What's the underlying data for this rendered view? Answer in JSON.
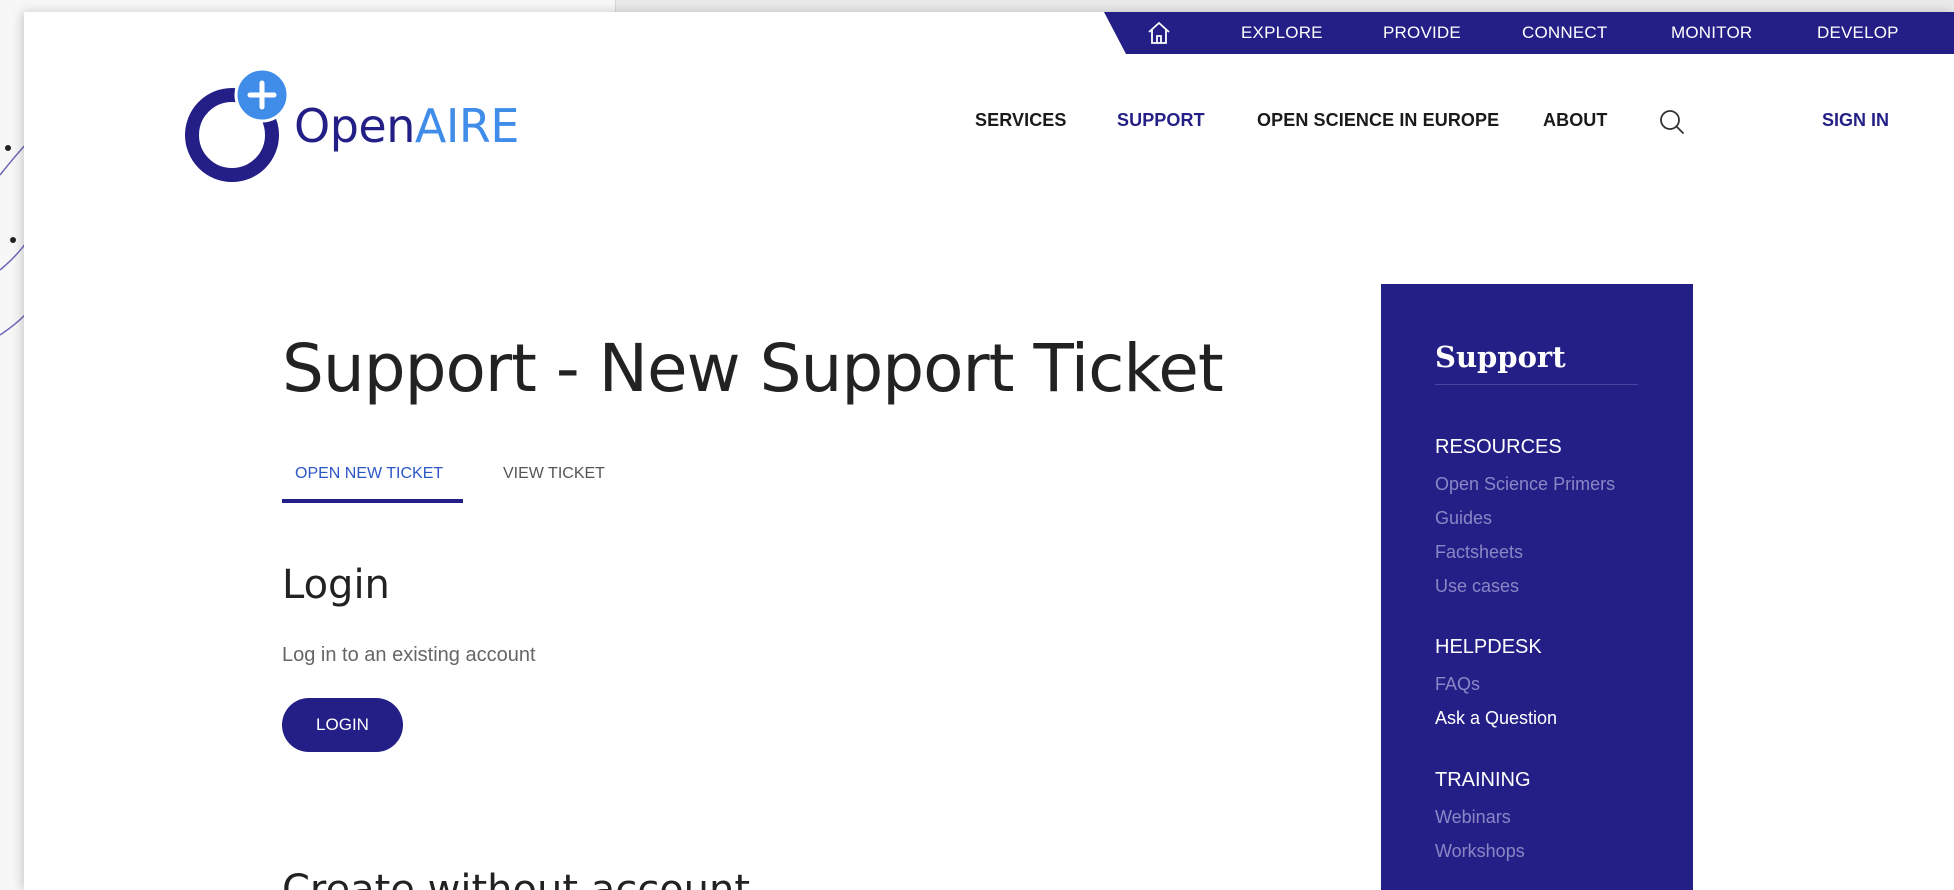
{
  "colors": {
    "primary": "#231f86",
    "accent": "#3f8de9",
    "tab_active": "#2b56c6",
    "sidebar_link": "#8a87c6"
  },
  "topbar": {
    "home_icon": "home-icon",
    "items": [
      "EXPLORE",
      "PROVIDE",
      "CONNECT",
      "MONITOR",
      "DEVELOP"
    ]
  },
  "logo": {
    "text_open": "Open",
    "text_aire": "AIRE"
  },
  "mainnav": {
    "items": [
      "SERVICES",
      "SUPPORT",
      "OPEN SCIENCE IN EUROPE",
      "ABOUT"
    ],
    "active": "SUPPORT",
    "search_icon": "search-icon",
    "signin": "SIGN IN"
  },
  "page": {
    "title": "Support - New Support Ticket",
    "tabs": [
      {
        "label": "OPEN NEW TICKET",
        "active": true
      },
      {
        "label": "VIEW TICKET",
        "active": false
      }
    ],
    "login": {
      "heading": "Login",
      "description": "Log in to an existing account",
      "button": "LOGIN"
    },
    "create": {
      "heading": "Create without account"
    }
  },
  "sidebar": {
    "title": "Support",
    "sections": [
      {
        "label": "RESOURCES",
        "links": [
          "Open Science Primers",
          "Guides",
          "Factsheets",
          "Use cases"
        ]
      },
      {
        "label": "HELPDESK",
        "links": [
          "FAQs",
          "Ask a Question"
        ]
      },
      {
        "label": "TRAINING",
        "links": [
          "Webinars",
          "Workshops"
        ]
      }
    ],
    "active_link": "Ask a Question"
  }
}
